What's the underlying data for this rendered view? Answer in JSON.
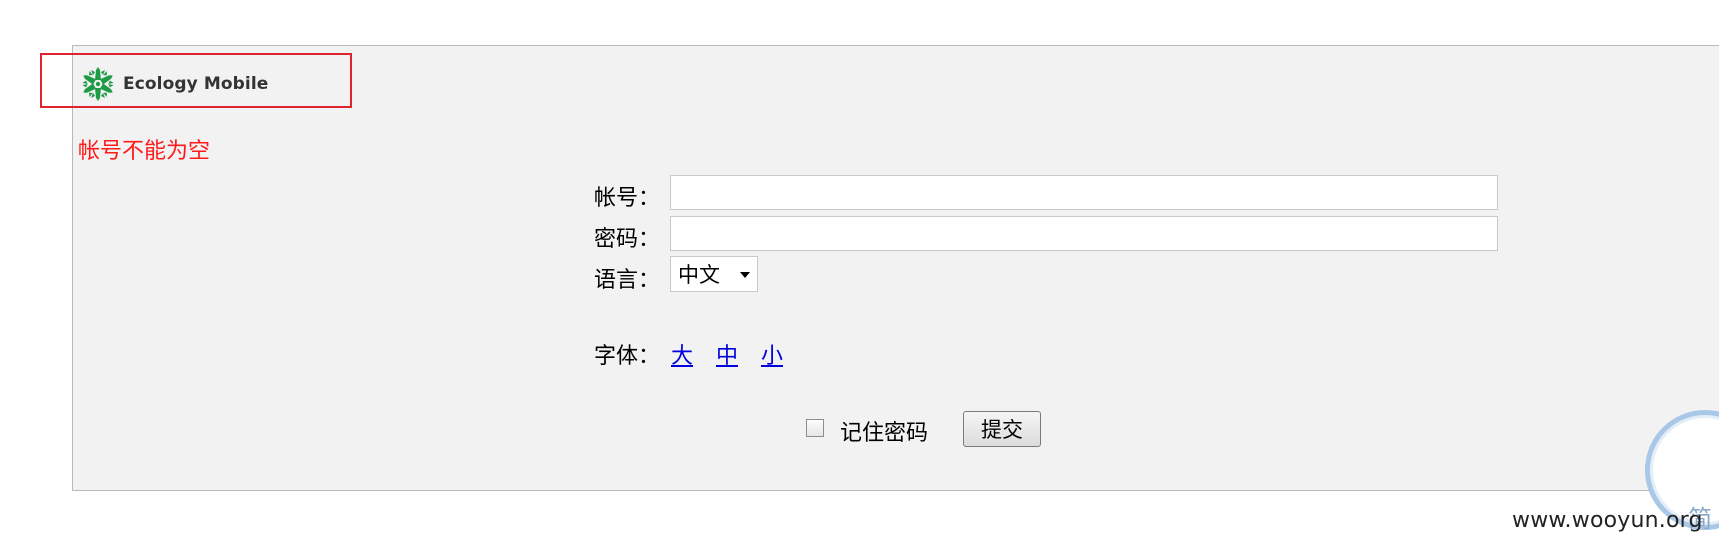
{
  "header": {
    "logo_text": "Ecology Mobile",
    "logo_icon": "ecology-snowflake-icon",
    "highlight_color": "#e0242f"
  },
  "error": {
    "message": "帐号不能为空",
    "color": "#ff1a1a"
  },
  "form": {
    "account_label": "帐号：",
    "account_value": "",
    "password_label": "密码：",
    "password_value": "",
    "language_label": "语言：",
    "language_selected": "中文",
    "font_label": "字体：",
    "font_options": [
      "大",
      "中",
      "小"
    ],
    "remember_label": "记住密码",
    "remember_checked": false,
    "submit_label": "提交"
  },
  "widget": {
    "label": "简"
  },
  "watermark": {
    "text": "www.wooyun.org"
  }
}
